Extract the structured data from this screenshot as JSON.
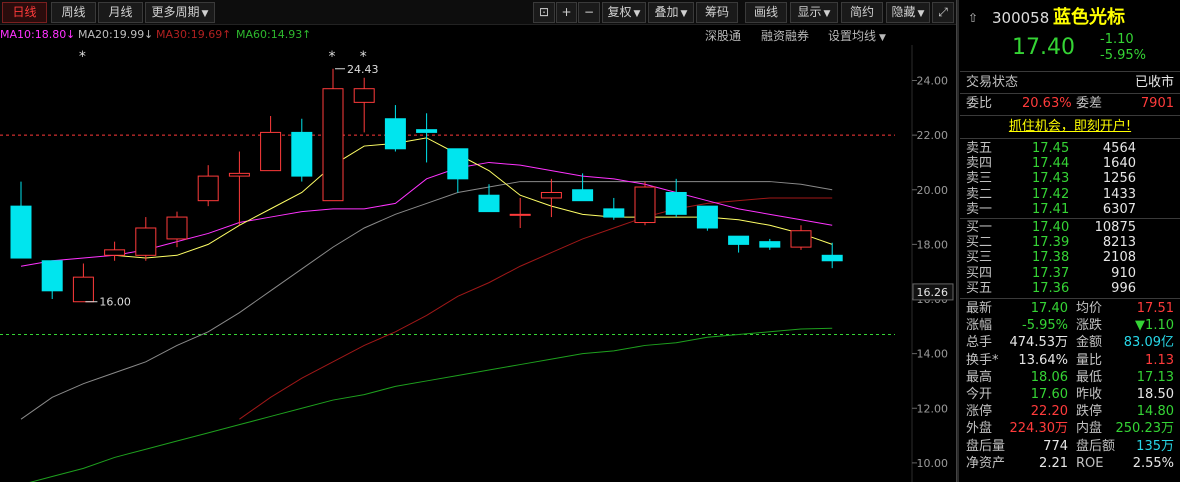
{
  "toolbar": {
    "daily": "日线",
    "weekly": "周线",
    "monthly": "月线",
    "more_periods": "更多周期",
    "adjust": "复权",
    "overlay": "叠加",
    "chips": "筹码",
    "draw": "画线",
    "display": "显示",
    "simple": "简约",
    "hide": "隐藏"
  },
  "ma_legend": {
    "ma10": "MA10:18.80",
    "ma20": "MA20:19.99",
    "ma30": "MA30:19.69",
    "ma60": "MA60:14.93",
    "ma10_arrow": "↓",
    "ma20_arrow": "↓",
    "ma30_arrow": "↑",
    "ma60_arrow": "↑"
  },
  "chart_links": {
    "hk_connect": "深股通",
    "margin": "融资融券",
    "set_ma": "设置均线"
  },
  "colors": {
    "up": "#ff3b3b",
    "down": "#00e5ee",
    "ma10": "#ffff66",
    "ma20": "#ff33ff",
    "ma30": "#a01818",
    "ma60": "#1ea01e",
    "ma_long": "#8a8a8a"
  },
  "chart_data": {
    "type": "candlestick",
    "ylim": [
      9.3,
      25.3
    ],
    "yticks": [
      "24.00",
      "22.00",
      "20.00",
      "18.00",
      "16.00",
      "14.00",
      "12.00",
      "10.00"
    ],
    "last_price_tag": "16.26",
    "candles": [
      {
        "o": 19.4,
        "c": 17.5,
        "h": 20.3,
        "l": 17.5
      },
      {
        "o": 17.4,
        "c": 16.3,
        "h": 17.4,
        "l": 16.0
      },
      {
        "o": 15.9,
        "c": 16.8,
        "h": 17.3,
        "l": 15.9
      },
      {
        "o": 17.6,
        "c": 17.8,
        "h": 18.1,
        "l": 17.4
      },
      {
        "o": 17.6,
        "c": 18.6,
        "h": 19.0,
        "l": 17.4
      },
      {
        "o": 18.2,
        "c": 19.0,
        "h": 19.2,
        "l": 17.9
      },
      {
        "o": 19.6,
        "c": 20.5,
        "h": 20.9,
        "l": 19.4
      },
      {
        "o": 20.5,
        "c": 20.6,
        "h": 21.4,
        "l": 18.7
      },
      {
        "o": 20.7,
        "c": 22.1,
        "h": 22.7,
        "l": 20.7
      },
      {
        "o": 22.1,
        "c": 20.5,
        "h": 22.6,
        "l": 20.3
      },
      {
        "o": 19.6,
        "c": 23.7,
        "h": 24.43,
        "l": 19.6
      },
      {
        "o": 23.2,
        "c": 23.7,
        "h": 24.1,
        "l": 22.1
      },
      {
        "o": 22.6,
        "c": 21.5,
        "h": 23.1,
        "l": 21.4
      },
      {
        "o": 22.2,
        "c": 22.1,
        "h": 22.8,
        "l": 21.0
      },
      {
        "o": 21.5,
        "c": 20.4,
        "h": 21.5,
        "l": 19.9
      },
      {
        "o": 19.8,
        "c": 19.2,
        "h": 20.2,
        "l": 19.2
      },
      {
        "o": 19.1,
        "c": 19.1,
        "h": 19.7,
        "l": 18.6
      },
      {
        "o": 19.7,
        "c": 19.9,
        "h": 20.4,
        "l": 19.0
      },
      {
        "o": 20.0,
        "c": 19.6,
        "h": 20.6,
        "l": 19.6
      },
      {
        "o": 19.3,
        "c": 19.0,
        "h": 19.7,
        "l": 18.9
      },
      {
        "o": 18.8,
        "c": 20.1,
        "h": 20.3,
        "l": 18.7
      },
      {
        "o": 19.9,
        "c": 19.1,
        "h": 20.4,
        "l": 19.0
      },
      {
        "o": 19.4,
        "c": 18.6,
        "h": 19.4,
        "l": 18.5
      },
      {
        "o": 18.3,
        "c": 18.0,
        "h": 18.3,
        "l": 17.7
      },
      {
        "o": 18.1,
        "c": 17.9,
        "h": 18.2,
        "l": 17.8
      },
      {
        "o": 17.9,
        "c": 18.5,
        "h": 18.7,
        "l": 17.8
      },
      {
        "o": 17.6,
        "c": 17.4,
        "h": 18.06,
        "l": 17.13
      }
    ],
    "high_label": "24.43",
    "low_label": "16.00",
    "ma_lines": {
      "ma10": [
        null,
        null,
        null,
        17.6,
        17.5,
        17.6,
        18.0,
        18.7,
        19.3,
        19.9,
        20.9,
        21.6,
        21.7,
        21.9,
        21.3,
        20.7,
        19.8,
        19.4,
        19.1,
        19.0,
        19.0,
        19.0,
        19.0,
        18.9,
        18.7,
        18.4,
        18.0
      ],
      "ma20": [
        17.2,
        17.4,
        17.5,
        17.6,
        17.8,
        18.1,
        18.4,
        18.8,
        19.0,
        19.2,
        19.3,
        19.3,
        19.5,
        20.4,
        20.8,
        21.0,
        20.9,
        20.7,
        20.5,
        20.4,
        20.2,
        19.9,
        19.6,
        19.3,
        19.1,
        18.9,
        18.7
      ],
      "ma_long": [
        11.6,
        12.4,
        12.9,
        13.3,
        13.7,
        14.3,
        14.8,
        15.5,
        16.3,
        17.1,
        17.9,
        18.6,
        19.1,
        19.5,
        19.9,
        20.1,
        20.3,
        20.3,
        20.3,
        20.3,
        20.3,
        20.3,
        20.3,
        20.3,
        20.3,
        20.2,
        20.0
      ],
      "ma30": [
        null,
        null,
        null,
        null,
        null,
        null,
        null,
        11.6,
        12.4,
        13.1,
        13.7,
        14.3,
        14.8,
        15.4,
        16.1,
        16.6,
        17.2,
        17.7,
        18.2,
        18.6,
        19.0,
        19.3,
        19.5,
        19.6,
        19.7,
        19.7,
        19.7
      ],
      "ma60": [
        9.2,
        9.5,
        9.8,
        10.2,
        10.5,
        10.8,
        11.1,
        11.4,
        11.7,
        12.0,
        12.3,
        12.5,
        12.8,
        13.0,
        13.2,
        13.4,
        13.6,
        13.8,
        14.0,
        14.1,
        14.3,
        14.4,
        14.6,
        14.7,
        14.8,
        14.9,
        14.93
      ]
    },
    "ref_lines": [
      22.0,
      14.7
    ]
  },
  "stock": {
    "code": "300058",
    "name": "蓝色光标",
    "price": "17.40",
    "change": "-1.10",
    "change_pct": "-5.95%"
  },
  "status": {
    "label": "交易状态",
    "value": "已收市"
  },
  "committee": {
    "ratio_label": "委比",
    "ratio": "20.63%",
    "diff_label": "委差",
    "diff": "7901"
  },
  "promo": "抓住机会，即刻开户!",
  "asks": [
    {
      "label": "卖五",
      "price": "17.45",
      "vol": "4564"
    },
    {
      "label": "卖四",
      "price": "17.44",
      "vol": "1640"
    },
    {
      "label": "卖三",
      "price": "17.43",
      "vol": "1256"
    },
    {
      "label": "卖二",
      "price": "17.42",
      "vol": "1433"
    },
    {
      "label": "卖一",
      "price": "17.41",
      "vol": "6307"
    }
  ],
  "bids": [
    {
      "label": "买一",
      "price": "17.40",
      "vol": "10875"
    },
    {
      "label": "买二",
      "price": "17.39",
      "vol": "8213"
    },
    {
      "label": "买三",
      "price": "17.38",
      "vol": "2108"
    },
    {
      "label": "买四",
      "price": "17.37",
      "vol": "910"
    },
    {
      "label": "买五",
      "price": "17.36",
      "vol": "996"
    }
  ],
  "stats": [
    {
      "l1": "最新",
      "v1": "17.40",
      "c1": "g",
      "l2": "均价",
      "v2": "17.51",
      "c2": "r"
    },
    {
      "l1": "涨幅",
      "v1": "-5.95%",
      "c1": "g",
      "l2": "涨跌",
      "v2": "▼1.10",
      "c2": "g"
    },
    {
      "l1": "总手",
      "v1": "474.53万",
      "c1": "w",
      "l2": "金额",
      "v2": "83.09亿",
      "c2": "c"
    },
    {
      "l1": "换手*",
      "v1": "13.64%",
      "c1": "w",
      "l2": "量比",
      "v2": "1.13",
      "c2": "r"
    },
    {
      "l1": "最高",
      "v1": "18.06",
      "c1": "g",
      "l2": "最低",
      "v2": "17.13",
      "c2": "g"
    },
    {
      "l1": "今开",
      "v1": "17.60",
      "c1": "g",
      "l2": "昨收",
      "v2": "18.50",
      "c2": "w"
    },
    {
      "l1": "涨停",
      "v1": "22.20",
      "c1": "r",
      "l2": "跌停",
      "v2": "14.80",
      "c2": "g"
    },
    {
      "l1": "外盘",
      "v1": "224.30万",
      "c1": "r",
      "l2": "内盘",
      "v2": "250.23万",
      "c2": "g"
    },
    {
      "l1": "盘后量",
      "v1": "774",
      "c1": "w",
      "l2": "盘后额",
      "v2": "135万",
      "c2": "c"
    },
    {
      "l1": "净资产",
      "v1": "2.21",
      "c1": "w",
      "l2": "ROE",
      "v2": "2.55%",
      "c2": "w"
    }
  ]
}
